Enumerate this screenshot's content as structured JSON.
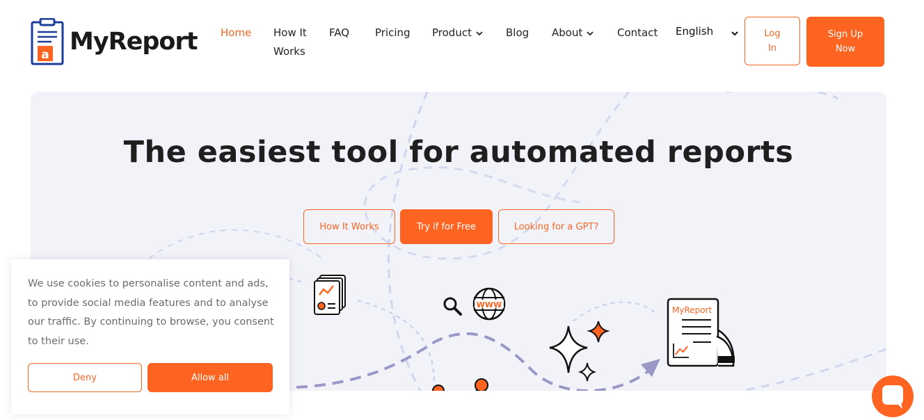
{
  "brand": {
    "name": "MyReport",
    "logo_icon": "clipboard-report-icon"
  },
  "nav": {
    "items": [
      {
        "label": "Home",
        "active": true
      },
      {
        "label": "How It",
        "label2": "Works"
      },
      {
        "label": "FAQ"
      },
      {
        "label": "Pricing"
      },
      {
        "label": "Product",
        "dropdown": true
      },
      {
        "label": "Blog"
      },
      {
        "label": "About",
        "dropdown": true
      },
      {
        "label": "Contact"
      }
    ],
    "language": "English",
    "login": {
      "line1": "Log",
      "line2": "In"
    },
    "signup": {
      "line1": "Sign Up",
      "line2": "Now"
    }
  },
  "hero": {
    "title": "The easiest tool for automated reports",
    "buttons": [
      "How It Works",
      "Try if for Free",
      "Looking for a GPT?"
    ],
    "illustration_label": "MyReport"
  },
  "cookie": {
    "text": "We use cookies to personalise content and ads, to provide social media features and to analyse our traffic. By continuing to browse, you consent to their use.",
    "deny": "Deny",
    "allow": "Allow all"
  },
  "colors": {
    "accent": "#fd6421",
    "navy": "#1d3d9a",
    "hero_bg": "#f2f3f9",
    "dash": "#9b97c6"
  }
}
